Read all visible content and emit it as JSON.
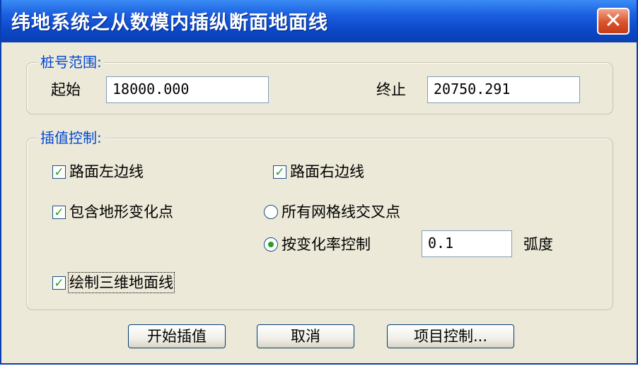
{
  "window": {
    "title": "纬地系统之从数模内插纵断面地面线",
    "close_symbol": "✕"
  },
  "station_range": {
    "label": "桩号范围:",
    "start_label": "起始",
    "start_value": "18000.000",
    "end_label": "终止",
    "end_value": "20750.291"
  },
  "interp_control": {
    "label": "插值控制:",
    "left_edge": {
      "label": "路面左边线",
      "checked": true
    },
    "right_edge": {
      "label": "路面右边线",
      "checked": true
    },
    "terrain_points": {
      "label": "包含地形变化点",
      "checked": true
    },
    "all_grid": {
      "label": "所有网格线交叉点",
      "selected": false
    },
    "by_rate": {
      "label": "按变化率控制",
      "selected": true,
      "value": "0.1",
      "unit": "弧度"
    },
    "draw_3d": {
      "label": "绘制三维地面线",
      "checked": true
    }
  },
  "buttons": {
    "start": "开始插值",
    "cancel": "取消",
    "project": "项目控制..."
  },
  "colors": {
    "title_bar": "#0a3fb0",
    "group_label": "#0046d5",
    "check": "#21a121",
    "close": "#d9532c"
  }
}
